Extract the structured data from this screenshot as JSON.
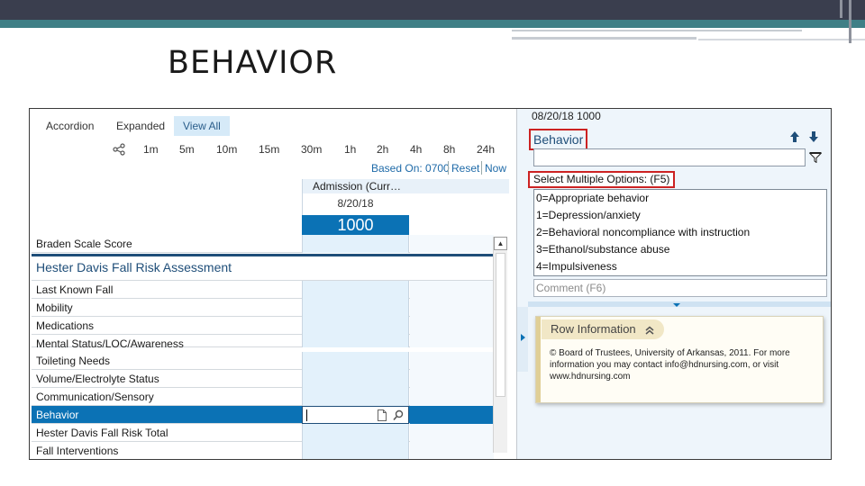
{
  "slide": {
    "title": "BEHAVIOR"
  },
  "tabs": {
    "accordion": "Accordion",
    "expanded": "Expanded",
    "view_all": "View All"
  },
  "time_intervals": [
    "1m",
    "5m",
    "10m",
    "15m",
    "30m",
    "1h",
    "2h",
    "4h",
    "8h",
    "24h"
  ],
  "based_on": {
    "label": "Based On: 0700",
    "reset": "Reset",
    "now": "Now"
  },
  "column": {
    "header": "Admission (Curr…",
    "date": "8/20/18",
    "time": "1000"
  },
  "rows": {
    "braden": "Braden Scale Score",
    "section_title": "Hester Davis Fall Risk Assessment",
    "items": [
      "Last Known Fall",
      "Mobility",
      "Medications",
      "Mental Status/LOC/Awareness",
      "Toileting Needs",
      "Volume/Electrolyte Status",
      "Communication/Sensory",
      "Behavior",
      "Hester Davis Fall Risk Total",
      "Fall Interventions"
    ]
  },
  "right_panel": {
    "datetime": "08/20/18 1000",
    "title": "Behavior",
    "select_label": "Select Multiple Options: (F5)",
    "options": [
      "0=Appropriate behavior",
      "1=Depression/anxiety",
      "2=Behavioral noncompliance with instruction",
      "3=Ethanol/substance abuse",
      "4=Impulsiveness"
    ],
    "comment_placeholder": "Comment (F6)",
    "row_info": {
      "title": "Row Information",
      "text": "© Board of Trustees, University of Arkansas, 2011. For more information you may contact info@hdnursing.com, or visit www.hdnursing.com"
    }
  },
  "colors": {
    "accent": "#0b72b5",
    "highlight_border": "#cc2222",
    "section_title": "#1f4e79",
    "header_bar": "#3a3e4e",
    "teal_bar": "#3f7f86"
  }
}
